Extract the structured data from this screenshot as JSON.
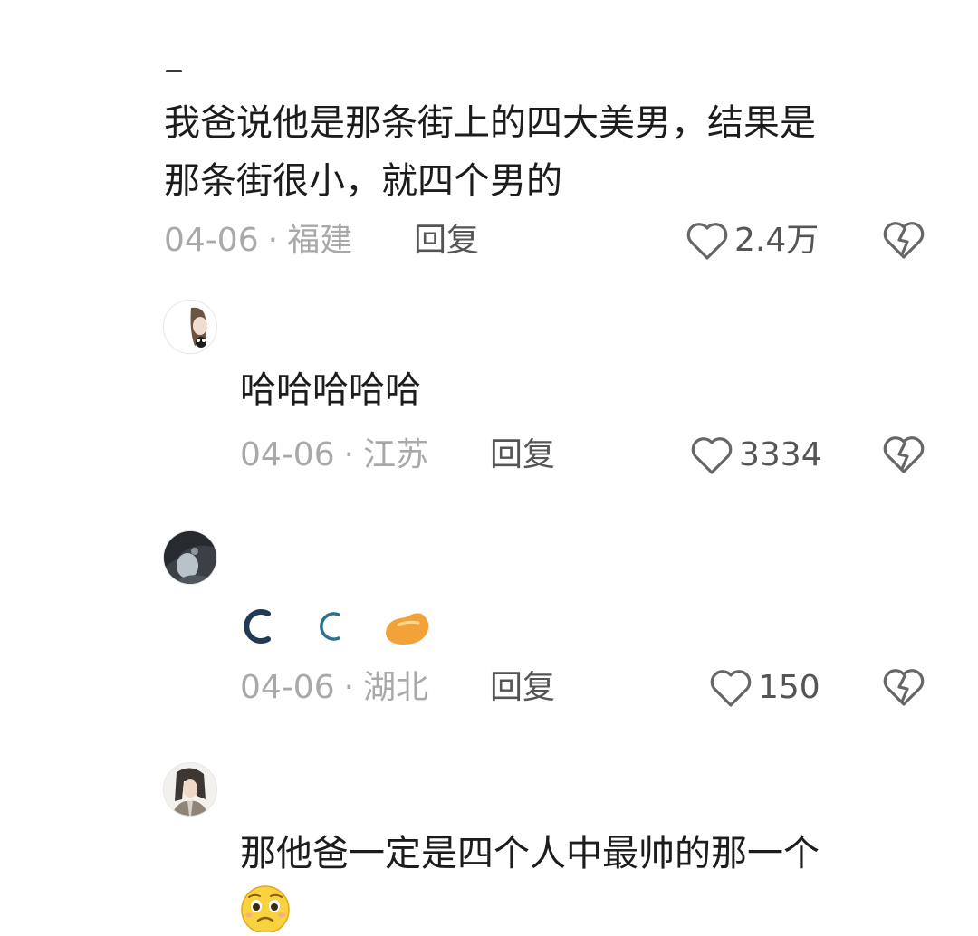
{
  "comments": [
    {
      "text": "我爸说他是那条街上的四大美男，结果是\n那条街很小，就四个男的",
      "date": "04-06",
      "separator": "·",
      "location": "福建",
      "reply_label": "回复",
      "likes": "2.4万",
      "avatar": "none"
    },
    {
      "text": "哈哈哈哈哈",
      "date": "04-06",
      "separator": "·",
      "location": "江苏",
      "reply_label": "回复",
      "likes": "3334",
      "avatar": "girl-with-panda-avatar"
    },
    {
      "text": "",
      "stickers": [
        "crescent-moon-icon",
        "crescent-moon-icon",
        "orange-blob-sticker-icon"
      ],
      "date": "04-06",
      "separator": "·",
      "location": "湖北",
      "reply_label": "回复",
      "likes": "150",
      "avatar": "dark-anime-avatar"
    },
    {
      "text": "那他爸一定是四个人中最帅的那一个",
      "stickers": [
        "pleading-face-emoji-icon"
      ],
      "avatar": "anime-swordsman-avatar"
    }
  ],
  "colors": {
    "text": "#1c1c1c",
    "meta": "#a9a9a9",
    "action": "#555555"
  }
}
